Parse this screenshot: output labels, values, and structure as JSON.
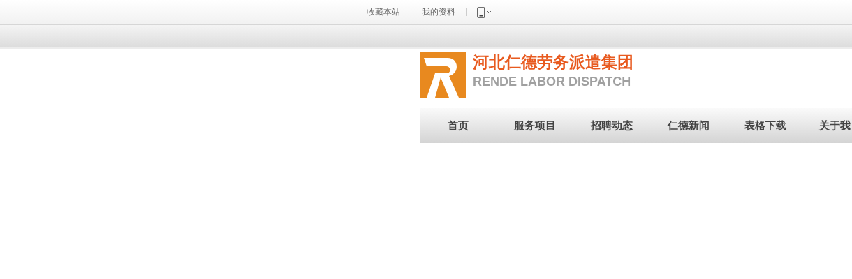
{
  "top_links": [
    {
      "label": "收藏本站"
    },
    {
      "label": "我的资料"
    }
  ],
  "logo": {
    "title": "河北仁德劳务派遣集团",
    "subtitle": "RENDE LABOR DISPATCH"
  },
  "nav": [
    {
      "label": "首页"
    },
    {
      "label": "服务项目"
    },
    {
      "label": "招聘动态"
    },
    {
      "label": "仁德新闻"
    },
    {
      "label": "表格下载"
    },
    {
      "label": "关于我"
    }
  ]
}
